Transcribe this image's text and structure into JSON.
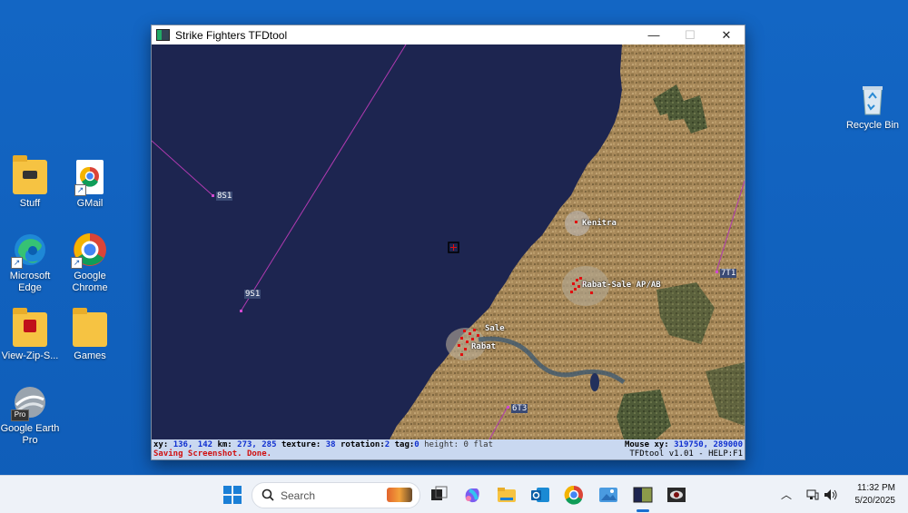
{
  "desktop": {
    "icons_left": [
      {
        "label": "Stuff",
        "icon": "folder-icon"
      },
      {
        "label": "GMail",
        "icon": "chrome-shortcut-icon"
      },
      {
        "label": "Microsoft Edge",
        "icon": "edge-icon"
      },
      {
        "label": "Google Chrome",
        "icon": "chrome-icon"
      },
      {
        "label": "View-Zip-S...",
        "icon": "folder-icon"
      },
      {
        "label": "Games",
        "icon": "folder-icon"
      },
      {
        "label": "Google Earth Pro",
        "icon": "google-earth-icon"
      }
    ],
    "recycle_bin": {
      "label": "Recycle Bin",
      "icon": "recycle-bin-icon"
    }
  },
  "window": {
    "title": "Strike Fighters TFDtool",
    "buttons": {
      "minimize": "—",
      "maximize": "☐",
      "close": "✕"
    }
  },
  "map": {
    "grid_labels": [
      "8S1",
      "9S1",
      "7T1",
      "6T3"
    ],
    "place_labels": [
      "Kenitra",
      "Rabat-Sale AP/AB",
      "Sale",
      "Rabat"
    ],
    "colors": {
      "sea": "#1d2550",
      "land": "#a88a58",
      "forest": "#4e5a36",
      "grid_line": "#b03ab0",
      "marker": "#e01010"
    }
  },
  "status": {
    "xy_label": "xy:",
    "xy_value": "136, 142",
    "km_label": "km:",
    "km_value": "273, 285",
    "texture_label": "texture:",
    "texture_value": "38",
    "rotation_label": "rotation:",
    "rotation_value": "2",
    "tag_label": "tag:",
    "tag_value": "0",
    "height_label": "height:",
    "height_value": "0 flat",
    "message": "Saving Screenshot. Done.",
    "mouse_label": "Mouse xy:",
    "mouse_value": "319750, 289000",
    "version": "TFDtool v1.01 - HELP:F1"
  },
  "taskbar": {
    "search_placeholder": "Search",
    "time": "11:32 PM",
    "date": "5/20/2025",
    "apps": [
      "start-icon",
      "search-icon",
      "task-view-icon",
      "copilot-icon",
      "file-explorer-icon",
      "outlook-icon",
      "chrome-icon",
      "photos-icon",
      "tfdtool-icon",
      "eye-app-icon"
    ],
    "tray": [
      "chevron-up-icon",
      "network-icon",
      "volume-icon"
    ]
  }
}
